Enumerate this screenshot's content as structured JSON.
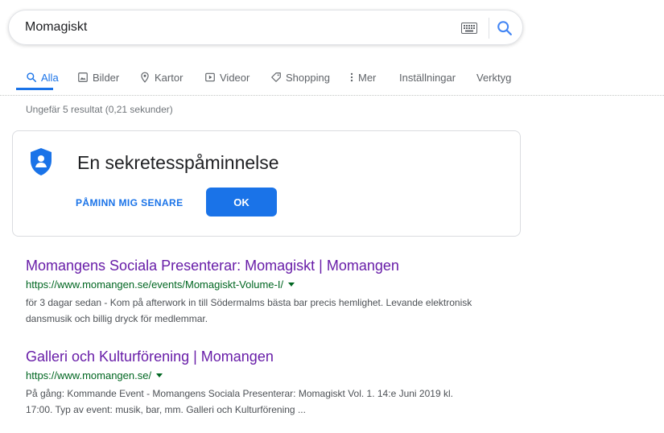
{
  "search": {
    "query": "Momagiskt"
  },
  "tabs": [
    {
      "label": "Alla",
      "icon": "search-icon",
      "active": true
    },
    {
      "label": "Bilder",
      "icon": "image-icon"
    },
    {
      "label": "Kartor",
      "icon": "map-pin-icon"
    },
    {
      "label": "Videor",
      "icon": "video-icon"
    },
    {
      "label": "Shopping",
      "icon": "tag-icon"
    },
    {
      "label": "Mer",
      "icon": "more-vert-icon"
    },
    {
      "label": "Inställningar"
    },
    {
      "label": "Verktyg"
    }
  ],
  "stats": "Ungefär 5 resultat (0,21 sekunder)",
  "privacy": {
    "title": "En sekretesspåminnelse",
    "remind_label": "PÅMINN MIG SENARE",
    "ok_label": "OK",
    "icon": "shield-user-icon"
  },
  "results": [
    {
      "title": "Momangens Sociala Presenterar: Momagiskt | Momangen",
      "url": "https://www.momangen.se/events/Momagiskt-Volume-I/",
      "snippet_line1": "för 3 dagar sedan - Kom på afterwork in till Södermalms bästa bar precis hemlighet. Levande elektronisk",
      "snippet_line2": "dansmusik och billig dryck för medlemmar."
    },
    {
      "title": "Galleri och Kulturförening | Momangen",
      "url": "https://www.momangen.se/",
      "snippet_line1": "På gång: Kommande Event - Momangens Sociala Presenterar: Momagiskt Vol. 1. 14:e Juni 2019 kl.",
      "snippet_line2": "17:00. Typ av event: musik, bar, mm. Galleri och Kulturförening ..."
    }
  ],
  "colors": {
    "accent": "#1a73e8",
    "visited_link": "#681da8",
    "url_green": "#006621"
  }
}
